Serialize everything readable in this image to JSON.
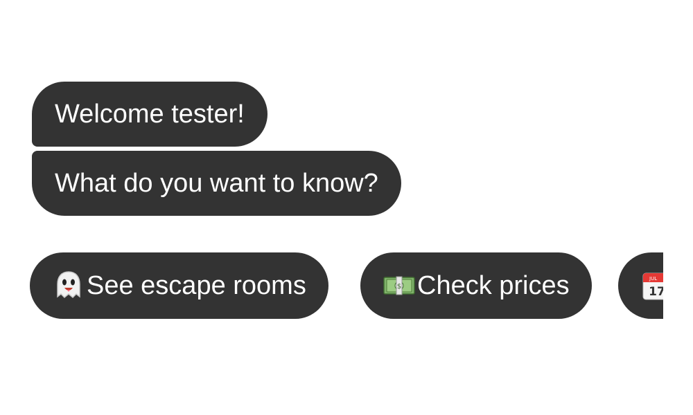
{
  "messages": [
    {
      "text": "Welcome tester!"
    },
    {
      "text": "What do you want to know?"
    }
  ],
  "quick_replies": [
    {
      "icon": "ghost-icon",
      "label": "See escape rooms"
    },
    {
      "icon": "money-icon",
      "label": "Check prices"
    },
    {
      "icon": "calendar-icon",
      "icon_text_month": "JUL",
      "icon_text_day": "17",
      "label": ""
    }
  ],
  "colors": {
    "bubble_bg": "#333333",
    "bubble_text": "#ffffff",
    "page_bg": "#ffffff"
  }
}
